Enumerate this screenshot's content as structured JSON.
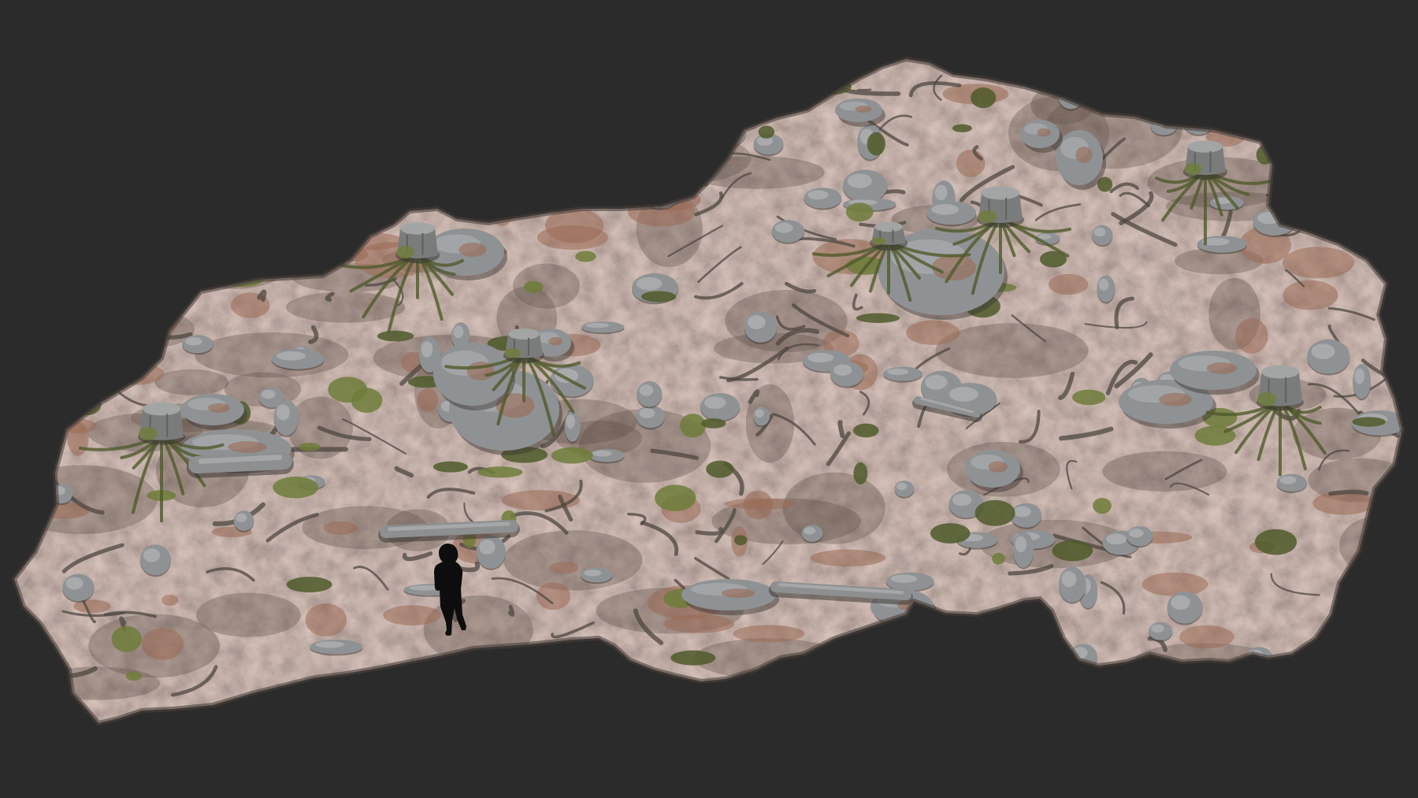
{
  "scene": {
    "subject": "photogrammetry-forest-floor-scan",
    "background_color": "#2b2b2b",
    "ground_colors": {
      "soil": "#7d6a62",
      "soil_dark": "#5e5049",
      "needles": "#9a6a54",
      "rock": "#8f9294",
      "rock_light": "#b2b5b7",
      "moss": "#6f7d3a",
      "moss_dark": "#4f5a2a",
      "root": "#4e4740",
      "stump": "#7a7c7c"
    },
    "figure_color": "#0d0d0d",
    "objects": {
      "tree_stumps": 7,
      "scale_figures": 1
    }
  }
}
